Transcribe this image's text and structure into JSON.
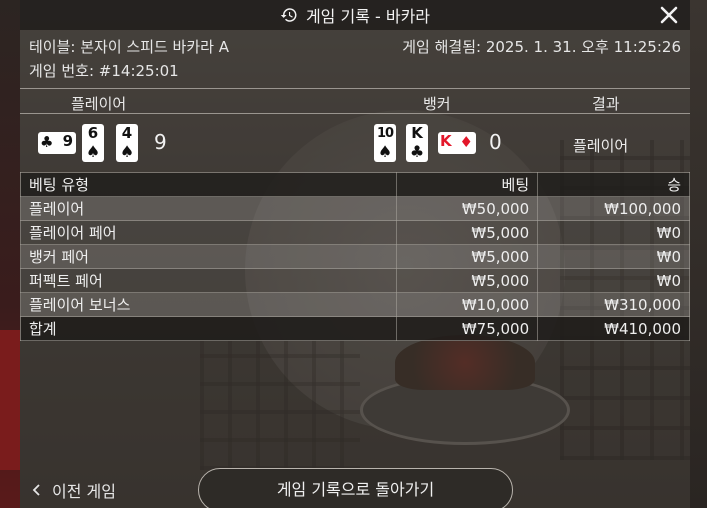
{
  "window": {
    "title": "게임 기록 - 바카라"
  },
  "info": {
    "table_label": "테이블: 본자이 스피드 바카라 A",
    "resolved_label": "게임 해결됨: 2025. 1. 31. 오후 11:25:26",
    "game_number_label": "게임 번호: #14:25:01"
  },
  "result": {
    "headers": {
      "player": "플레이어",
      "banker": "뱅커",
      "outcome": "결과"
    },
    "player": {
      "cards": [
        {
          "rank": "9",
          "suit": "♣",
          "color": "#111111",
          "sideways": true
        },
        {
          "rank": "6",
          "suit": "♠",
          "color": "#111111",
          "sideways": false
        },
        {
          "rank": "4",
          "suit": "♠",
          "color": "#111111",
          "sideways": false
        }
      ],
      "score": "9"
    },
    "banker": {
      "cards": [
        {
          "rank": "10",
          "suit": "♠",
          "color": "#111111",
          "sideways": false
        },
        {
          "rank": "K",
          "suit": "♣",
          "color": "#111111",
          "sideways": false
        },
        {
          "rank": "K",
          "suit": "♦",
          "color": "#e3172a",
          "sideways": true
        }
      ],
      "score": "0"
    },
    "outcome": "플레이어"
  },
  "bets": {
    "headers": {
      "type": "베팅 유형",
      "bet": "베팅",
      "win": "승"
    },
    "rows": [
      {
        "type": "플레이어",
        "bet": "₩50,000",
        "win": "₩100,000"
      },
      {
        "type": "플레이어 페어",
        "bet": "₩5,000",
        "win": "₩0"
      },
      {
        "type": "뱅커 페어",
        "bet": "₩5,000",
        "win": "₩0"
      },
      {
        "type": "퍼펙트 페어",
        "bet": "₩5,000",
        "win": "₩0"
      },
      {
        "type": "플레이어 보너스",
        "bet": "₩10,000",
        "win": "₩310,000"
      }
    ],
    "total": {
      "type": "합계",
      "bet": "₩75,000",
      "win": "₩410,000"
    }
  },
  "footer": {
    "prev_label": "이전 게임",
    "back_label": "게임 기록으로 돌아가기"
  },
  "icons": {
    "title": "history-icon",
    "close": "close-icon",
    "prev": "chevron-left-icon"
  }
}
